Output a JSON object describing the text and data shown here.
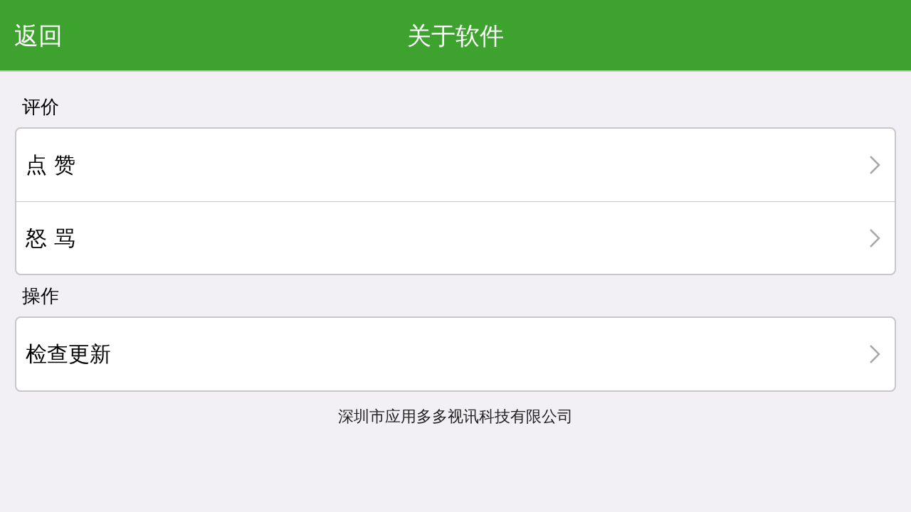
{
  "nav_bar": {
    "back": "返回",
    "title": "关于软件"
  },
  "sections": [
    {
      "header": "评价",
      "items": [
        {
          "label": "点 赞"
        },
        {
          "label": "怒 骂"
        }
      ]
    },
    {
      "header": "操作",
      "items": [
        {
          "label": "检查更新"
        }
      ]
    }
  ],
  "footer": "深圳市应用多多视讯科技有限公司"
}
